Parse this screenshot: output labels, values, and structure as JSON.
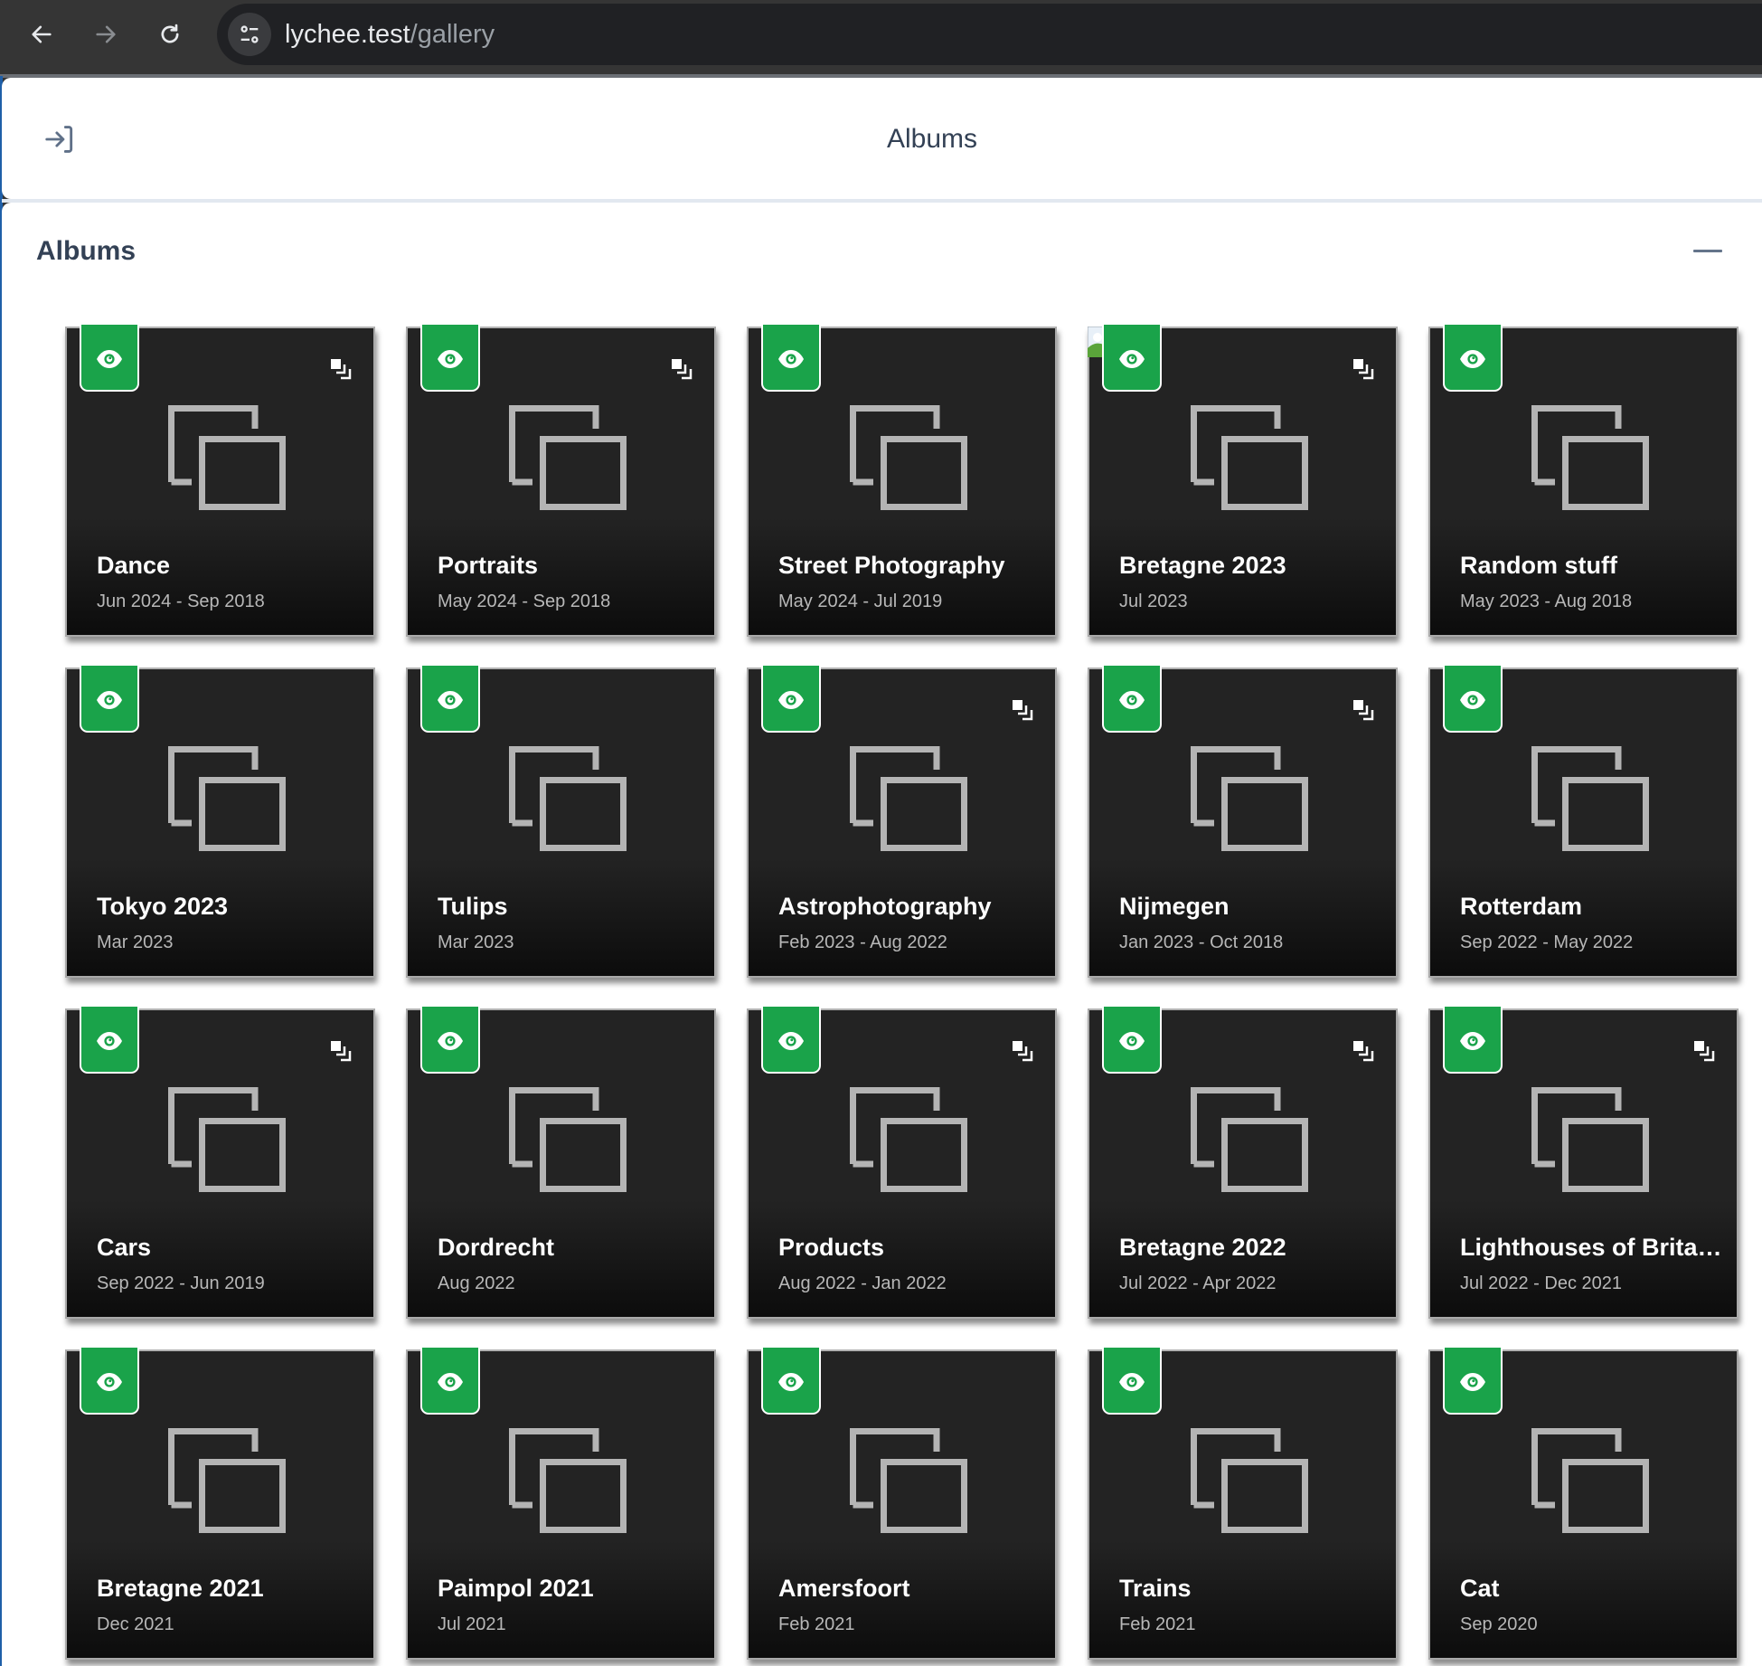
{
  "browser": {
    "url_host": "lychee.test",
    "url_path": "/gallery",
    "icons": {
      "back": "arrow-left-icon",
      "forward": "arrow-right-icon",
      "reload": "reload-icon",
      "site_info": "tune-icon"
    }
  },
  "header": {
    "title": "Albums",
    "login_icon": "sign-in-icon"
  },
  "section": {
    "title": "Albums",
    "collapse_icon": "minus-icon"
  },
  "colors": {
    "badge_green": "#1aa34a",
    "card_bg": "#232323",
    "text_slate": "#334155"
  },
  "albums": [
    {
      "title": "Dance",
      "date": "Jun 2024 - Sep 2018",
      "public": true,
      "has_subalbums": true,
      "broken_thumb": false
    },
    {
      "title": "Portraits",
      "date": "May 2024 - Sep 2018",
      "public": true,
      "has_subalbums": true,
      "broken_thumb": false
    },
    {
      "title": "Street Photography",
      "date": "May 2024 - Jul 2019",
      "public": true,
      "has_subalbums": false,
      "broken_thumb": false
    },
    {
      "title": "Bretagne 2023",
      "date": "Jul 2023",
      "public": true,
      "has_subalbums": true,
      "broken_thumb": true
    },
    {
      "title": "Random stuff",
      "date": "May 2023 - Aug 2018",
      "public": true,
      "has_subalbums": false,
      "broken_thumb": false
    },
    {
      "title": "Tokyo 2023",
      "date": "Mar 2023",
      "public": true,
      "has_subalbums": false,
      "broken_thumb": false
    },
    {
      "title": "Tulips",
      "date": "Mar 2023",
      "public": true,
      "has_subalbums": false,
      "broken_thumb": false
    },
    {
      "title": "Astrophotography",
      "date": "Feb 2023 - Aug 2022",
      "public": true,
      "has_subalbums": true,
      "broken_thumb": false
    },
    {
      "title": "Nijmegen",
      "date": "Jan 2023 - Oct 2018",
      "public": true,
      "has_subalbums": true,
      "broken_thumb": false
    },
    {
      "title": "Rotterdam",
      "date": "Sep 2022 - May 2022",
      "public": true,
      "has_subalbums": false,
      "broken_thumb": false
    },
    {
      "title": "Cars",
      "date": "Sep 2022 - Jun 2019",
      "public": true,
      "has_subalbums": true,
      "broken_thumb": false
    },
    {
      "title": "Dordrecht",
      "date": "Aug 2022",
      "public": true,
      "has_subalbums": false,
      "broken_thumb": false
    },
    {
      "title": "Products",
      "date": "Aug 2022 - Jan 2022",
      "public": true,
      "has_subalbums": true,
      "broken_thumb": false
    },
    {
      "title": "Bretagne 2022",
      "date": "Jul 2022 - Apr 2022",
      "public": true,
      "has_subalbums": true,
      "broken_thumb": false
    },
    {
      "title": "Lighthouses of Brita…",
      "date": "Jul 2022 - Dec 2021",
      "public": true,
      "has_subalbums": true,
      "broken_thumb": false
    },
    {
      "title": "Bretagne 2021",
      "date": "Dec 2021",
      "public": true,
      "has_subalbums": false,
      "broken_thumb": false
    },
    {
      "title": "Paimpol 2021",
      "date": "Jul 2021",
      "public": true,
      "has_subalbums": false,
      "broken_thumb": false
    },
    {
      "title": "Amersfoort",
      "date": "Feb 2021",
      "public": true,
      "has_subalbums": false,
      "broken_thumb": false
    },
    {
      "title": "Trains",
      "date": "Feb 2021",
      "public": true,
      "has_subalbums": false,
      "broken_thumb": false
    },
    {
      "title": "Cat",
      "date": "Sep 2020",
      "public": true,
      "has_subalbums": false,
      "broken_thumb": false
    }
  ]
}
